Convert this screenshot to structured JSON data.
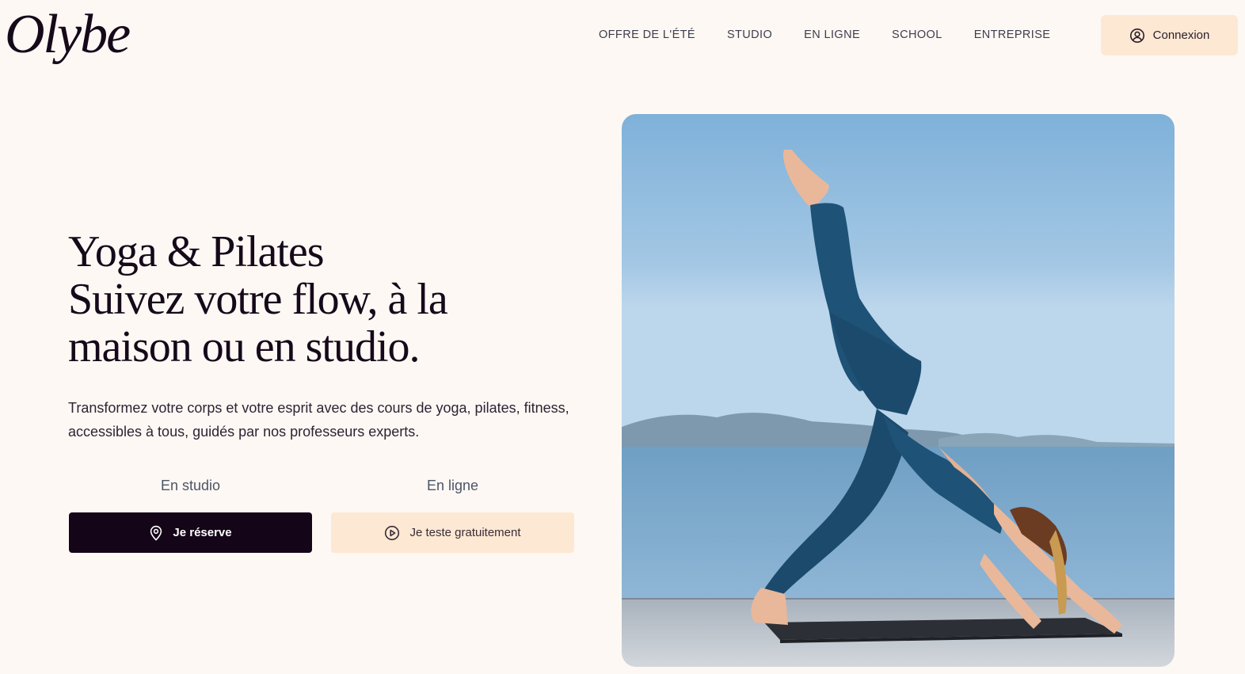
{
  "brand": {
    "logo_text": "Olybe"
  },
  "nav": {
    "items": [
      {
        "label": "OFFRE DE L'ÉTÉ"
      },
      {
        "label": "STUDIO"
      },
      {
        "label": "EN LIGNE"
      },
      {
        "label": "SCHOOL"
      },
      {
        "label": "ENTREPRISE"
      }
    ],
    "login_label": "Connexion",
    "login_icon": "user-circle-icon"
  },
  "hero": {
    "title_lines": [
      "Yoga & Pilates",
      "Suivez votre flow, à la",
      "maison ou en studio."
    ],
    "description": "Transformez votre corps et votre esprit avec des cours de yoga, pilates, fitness, accessibles à tous, guidés par nos professeurs experts.",
    "studio_label": "En studio",
    "studio_button": "Je réserve",
    "studio_icon": "map-pin-icon",
    "online_label": "En ligne",
    "online_button": "Je teste gratuitement",
    "online_icon": "play-circle-icon",
    "image_alt": "Woman in a three-legged downward dog yoga pose on a mat by the sea"
  },
  "colors": {
    "background": "#fef8f4",
    "accent_peach": "#fde8d3",
    "dark_button": "#150519",
    "text_dark": "#15091a"
  }
}
